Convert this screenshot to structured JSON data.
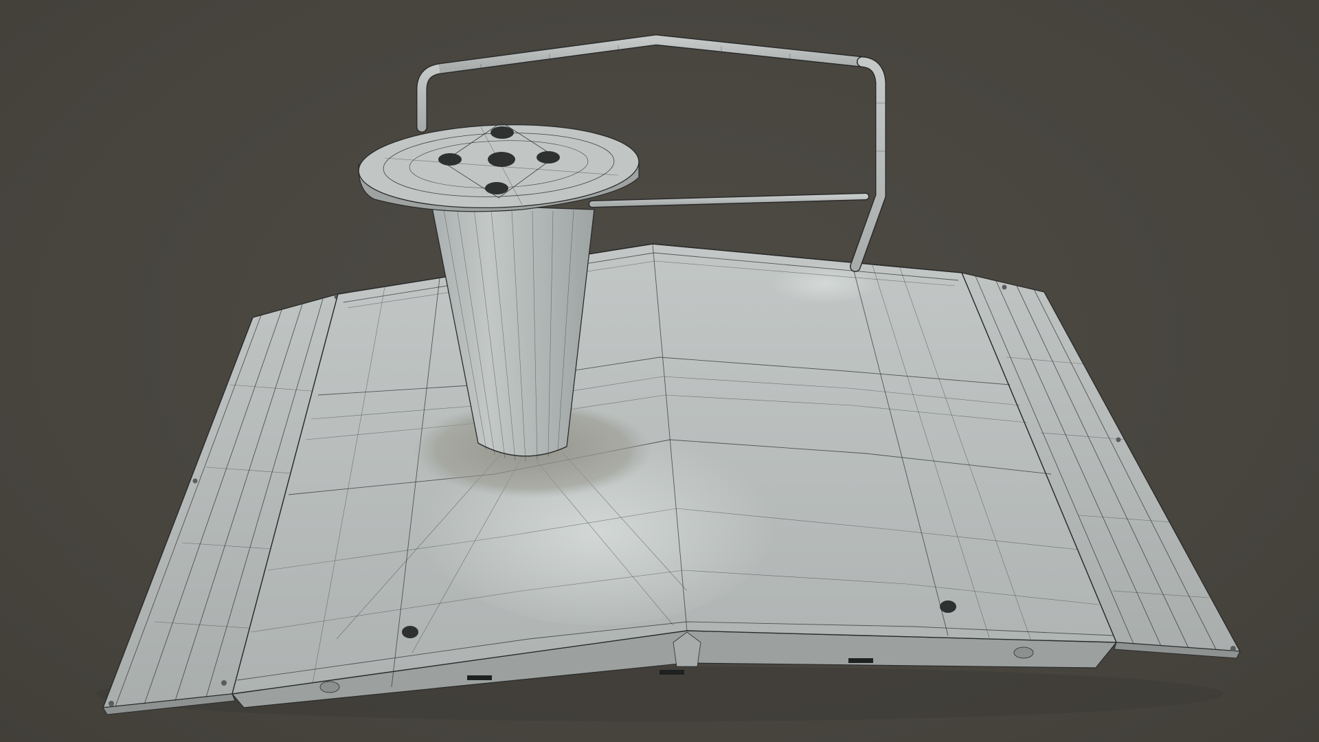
{
  "viewport": {
    "background_color": "#4a4741",
    "mesh_color": "#b9bebd",
    "wire_color": "#2e2f2f"
  },
  "model": {
    "parts": [
      {
        "name": "ramp-base"
      },
      {
        "name": "left-flap"
      },
      {
        "name": "right-flap"
      },
      {
        "name": "center-column"
      },
      {
        "name": "oval-top-plate"
      },
      {
        "name": "tubular-handrail"
      }
    ],
    "top_plate_hole_count": 5,
    "base_bolt_hole_count": 2
  }
}
